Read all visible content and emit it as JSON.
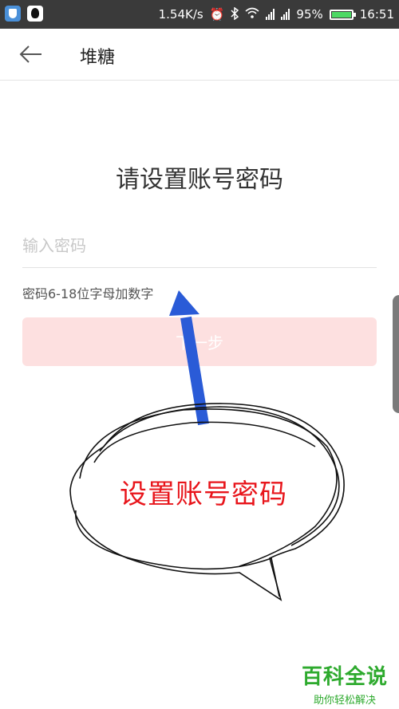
{
  "status_bar": {
    "net_speed": "1.54K/s",
    "battery": "95%",
    "battery_level": 0.95,
    "time": "16:51",
    "icons": [
      "shield-app-icon",
      "qq-app-icon",
      "alarm-icon",
      "bluetooth-icon",
      "wifi-icon",
      "signal-icon",
      "battery-icon"
    ]
  },
  "header": {
    "title": "堆糖",
    "back_icon": "arrow-left-icon"
  },
  "main": {
    "heading": "请设置账号密码",
    "password_placeholder": "输入密码",
    "password_value": "",
    "hint": "密码6-18位字母加数字",
    "next_label": "下一步"
  },
  "annotation": {
    "callout_text": "设置账号密码",
    "arrow_color": "#2a5bd7",
    "text_color": "#e8151b"
  },
  "watermark": {
    "title": "百科全说",
    "subtitle": "助你轻松解决"
  },
  "colors": {
    "accent_disabled": "#fde0e0",
    "status_bar_bg": "#3a3a3a",
    "watermark": "#2eaa2e"
  }
}
